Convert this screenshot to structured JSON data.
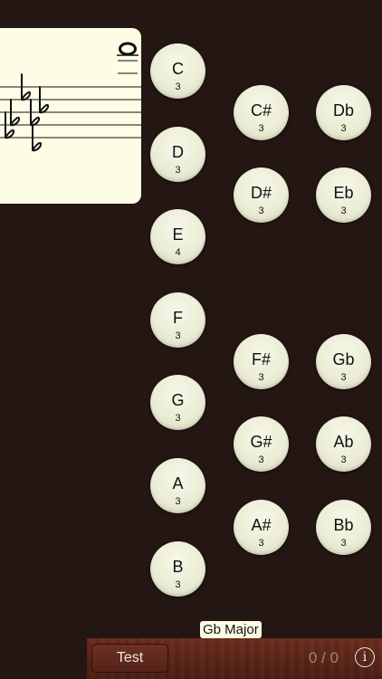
{
  "key": {
    "label": "Gb Major"
  },
  "notes_natural": [
    {
      "name": "C",
      "octave": "3"
    },
    {
      "name": "D",
      "octave": "3"
    },
    {
      "name": "E",
      "octave": "4"
    },
    {
      "name": "F",
      "octave": "3"
    },
    {
      "name": "G",
      "octave": "3"
    },
    {
      "name": "A",
      "octave": "3"
    },
    {
      "name": "B",
      "octave": "3"
    }
  ],
  "notes_sharp": [
    {
      "name": "C#",
      "octave": "3"
    },
    {
      "name": "D#",
      "octave": "3"
    },
    {
      "name": "F#",
      "octave": "3"
    },
    {
      "name": "G#",
      "octave": "3"
    },
    {
      "name": "A#",
      "octave": "3"
    }
  ],
  "notes_flat": [
    {
      "name": "Db",
      "octave": "3"
    },
    {
      "name": "Eb",
      "octave": "3"
    },
    {
      "name": "Gb",
      "octave": "3"
    },
    {
      "name": "Ab",
      "octave": "3"
    },
    {
      "name": "Bb",
      "octave": "3"
    }
  ],
  "toolbar": {
    "test_label": "Test",
    "score": "0 / 0",
    "info_icon": "i"
  },
  "staff": {
    "key_signature": "flats",
    "flat_count": 6
  },
  "colors": {
    "background": "#241613",
    "card": "#fdfde6",
    "wood": "#5a2518"
  }
}
